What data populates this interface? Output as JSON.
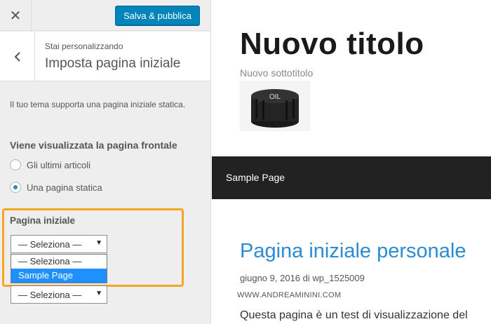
{
  "sidebar": {
    "close_icon": "close-icon",
    "publish_label": "Salva & pubblica",
    "publish_color": "#0085ba",
    "back_icon": "chevron-left-icon",
    "customizing_label": "Stai personalizzando",
    "section_title": "Imposta pagina iniziale",
    "description": "Il tuo tema supporta una pagina iniziale statica.",
    "front_display": {
      "title": "Viene visualizzata la pagina frontale",
      "options": [
        {
          "label": "Gli ultimi articoli",
          "checked": false
        },
        {
          "label": "Una pagina statica",
          "checked": true
        }
      ]
    },
    "homepage": {
      "title": "Pagina iniziale",
      "selected_value": "— Seleziona —",
      "dropdown_options": [
        "— Seleziona —",
        "Sample Page"
      ],
      "highlighted_option": "Sample Page"
    },
    "posts_page": {
      "selected_value": "— Seleziona —"
    },
    "highlight_color": "#f5a623"
  },
  "preview": {
    "site_title": "Nuovo titolo",
    "site_tagline": "Nuovo sottotitolo",
    "logo_text": "OIL",
    "nav_items": [
      "Sample Page"
    ],
    "page_heading": "Pagina iniziale personale",
    "post_date": "giugno 9, 2016",
    "post_by": "di",
    "post_author": "wp_1525009",
    "watermark": "WWW.ANDREAMININI.COM",
    "body_text": "Questa pagina è un test di visualizzazione del",
    "heading_color": "#2b8bd4"
  }
}
